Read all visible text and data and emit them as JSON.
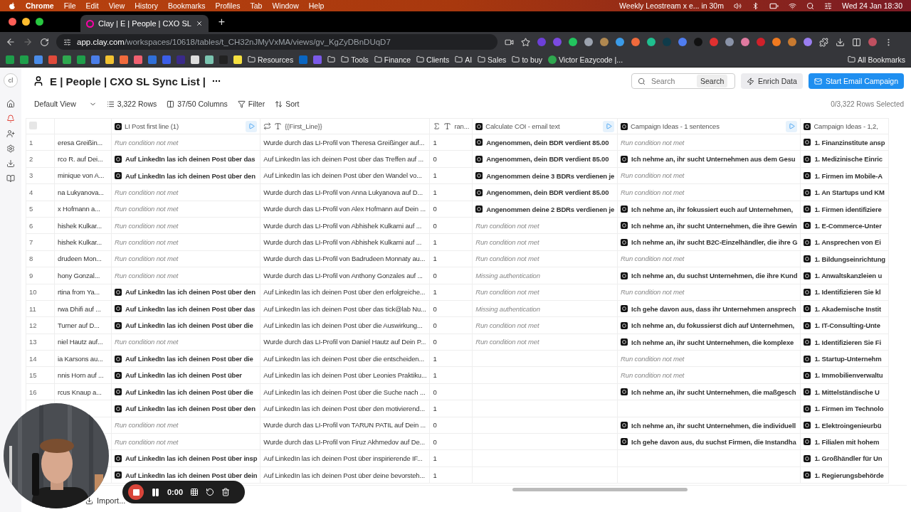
{
  "menubar": {
    "app": "Chrome",
    "menus": [
      "File",
      "Edit",
      "View",
      "History",
      "Bookmarks",
      "Profiles",
      "Tab",
      "Window",
      "Help"
    ],
    "event": "Weekly Leostream x e... in 30m",
    "clock": "Wed 24 Jan  18:30"
  },
  "browser": {
    "tabs": [
      {
        "title": "Clay | E | People | CXO SL",
        "selected": true
      }
    ],
    "new_tab": "+",
    "url_host": "app.clay.com",
    "url_path": "/workspaces/10618/tables/t_CH32nJMyVxMA/views/gv_KgZyDBnDUqD7",
    "extensions": [
      {
        "color": "#6d3fd8"
      },
      {
        "color": "#7b4ae0"
      },
      {
        "color": "#22c55e"
      },
      {
        "color": "#9ca3af"
      },
      {
        "color": "#b08850"
      },
      {
        "color": "#3b9be8"
      },
      {
        "color": "#f06a3c"
      },
      {
        "color": "#1fbf8f"
      },
      {
        "color": "#0f3b4a"
      },
      {
        "color": "#4f7df0"
      },
      {
        "color": "#111111"
      },
      {
        "color": "#e03030"
      },
      {
        "color": "#8a93a8"
      },
      {
        "color": "#e07aa0"
      },
      {
        "color": "#d0202a"
      },
      {
        "color": "#f07a20"
      },
      {
        "color": "#c87a30"
      },
      {
        "color": "#9a7ef0"
      }
    ],
    "bookmarks": [
      {
        "kind": "site",
        "color": "#1e9e4a"
      },
      {
        "kind": "site",
        "color": "#1e9e4a"
      },
      {
        "kind": "site",
        "color": "#4a8ce8"
      },
      {
        "kind": "site",
        "color": "#e04a3a"
      },
      {
        "kind": "site",
        "color": "#2fa84f"
      },
      {
        "kind": "site",
        "color": "#1e9e4a"
      },
      {
        "kind": "site",
        "color": "#4a7ee8"
      },
      {
        "kind": "site",
        "color": "#f2c230"
      },
      {
        "kind": "site",
        "color": "#f06a3c"
      },
      {
        "kind": "site",
        "color": "#f06070"
      },
      {
        "kind": "site",
        "color": "#2f6fd8"
      },
      {
        "kind": "site",
        "color": "#3b5ee8"
      },
      {
        "kind": "site",
        "color": "#3a2a8a"
      },
      {
        "kind": "site",
        "color": "#dddddd"
      },
      {
        "kind": "site",
        "color": "#7ac4b0"
      },
      {
        "kind": "site",
        "color": "#222222"
      },
      {
        "kind": "site",
        "color": "#f5e040"
      },
      {
        "kind": "folder",
        "label": "Resources"
      },
      {
        "kind": "site",
        "color": "#0a66c2"
      },
      {
        "kind": "site",
        "color": "#7b5ae8"
      },
      {
        "kind": "folder_icon"
      },
      {
        "kind": "folder",
        "label": "Tools"
      },
      {
        "kind": "folder",
        "label": "Finance"
      },
      {
        "kind": "folder",
        "label": "Clients"
      },
      {
        "kind": "folder",
        "label": "AI"
      },
      {
        "kind": "folder",
        "label": "Sales"
      },
      {
        "kind": "folder",
        "label": "to buy"
      },
      {
        "kind": "link",
        "label": "Victor Eazycode |...",
        "color": "#2fa84f"
      }
    ],
    "all_bookmarks": "All Bookmarks"
  },
  "workspace": {
    "avatar": "cl",
    "title": "E | People | CXO SL Sync List |",
    "search": {
      "placeholder": "Search",
      "button": "Search"
    },
    "enrich_button": "Enrich Data",
    "campaign_button": "Start Email Campaign",
    "toolbar": {
      "view": "Default View",
      "rows": "3,322 Rows",
      "columns": "37/50 Columns",
      "filter": "Filter",
      "sort": "Sort"
    },
    "selection": "0/3,322 Rows Selected",
    "import": "Import..."
  },
  "table": {
    "select_all": {
      "checked": false
    },
    "columns": [
      {
        "kind": "ai",
        "title": "LI Post first line (1)",
        "run_button": true
      },
      {
        "kind": "text_formula",
        "title": "{{First_Line}}",
        "run_button": false
      },
      {
        "kind": "number_formula",
        "title": "ran...",
        "run_button": false
      },
      {
        "kind": "ai",
        "title": "Calculate COI - email text",
        "run_button": true
      },
      {
        "kind": "ai",
        "title": "Campaign Ideas - 1 sentences",
        "run_button": true
      },
      {
        "kind": "ai",
        "title": "Campaign Ideas - 1,2,",
        "run_button": false
      }
    ],
    "rows": [
      {
        "number": "1",
        "name": "eresa Greißin...",
        "cells": [
          {
            "kind": "status",
            "text": "Run condition not met"
          },
          {
            "kind": "plain",
            "text": "Wurde durch das LI-Profil von Theresa Greißinger auf..."
          },
          {
            "kind": "plain",
            "text": "1"
          },
          {
            "kind": "ai",
            "text": "Angenommen, dein BDR verdient 85.00"
          },
          {
            "kind": "status",
            "text": "Run condition not met"
          },
          {
            "kind": "ai",
            "text": "1. Finanzinstitute ansp"
          }
        ]
      },
      {
        "number": "2",
        "name": "rco R. auf Dei...",
        "cells": [
          {
            "kind": "ai",
            "text": "Auf LinkedIn las ich deinen Post über das"
          },
          {
            "kind": "plain",
            "text": "Auf LinkedIn las ich deinen Post über das Treffen auf ..."
          },
          {
            "kind": "plain",
            "text": "0"
          },
          {
            "kind": "ai",
            "text": "Angenommen, dein BDR verdient 85.00"
          },
          {
            "kind": "ai",
            "text": "Ich nehme an, ihr sucht Unternehmen aus dem Gesu"
          },
          {
            "kind": "ai",
            "text": "1. Medizinische Einric"
          }
        ]
      },
      {
        "number": "3",
        "name": "minique von A...",
        "cells": [
          {
            "kind": "ai",
            "text": "Auf LinkedIn las ich deinen Post über den"
          },
          {
            "kind": "plain",
            "text": "Auf LinkedIn las ich deinen Post über den Wandel vo..."
          },
          {
            "kind": "plain",
            "text": "1"
          },
          {
            "kind": "ai",
            "text": "Angenommen deine 3 BDRs verdienen je"
          },
          {
            "kind": "status",
            "text": "Run condition not met"
          },
          {
            "kind": "ai",
            "text": "1. Firmen im Mobile-A"
          }
        ]
      },
      {
        "number": "4",
        "name": "na Lukyanova...",
        "cells": [
          {
            "kind": "status",
            "text": "Run condition not met"
          },
          {
            "kind": "plain",
            "text": "Wurde durch das LI-Profil von Anna Lukyanova auf D..."
          },
          {
            "kind": "plain",
            "text": "1"
          },
          {
            "kind": "ai",
            "text": "Angenommen, dein BDR verdient 85.00"
          },
          {
            "kind": "status",
            "text": "Run condition not met"
          },
          {
            "kind": "ai",
            "text": "1. An Startups und KM"
          }
        ]
      },
      {
        "number": "5",
        "name": "x Hofmann a...",
        "cells": [
          {
            "kind": "status",
            "text": "Run condition not met"
          },
          {
            "kind": "plain",
            "text": "Wurde durch das LI-Profil von Alex Hofmann auf Dein ..."
          },
          {
            "kind": "plain",
            "text": "0"
          },
          {
            "kind": "ai",
            "text": "Angenommen deine 2 BDRs verdienen je"
          },
          {
            "kind": "ai",
            "text": "Ich nehme an, ihr fokussiert euch auf Unternehmen,"
          },
          {
            "kind": "ai",
            "text": "1. Firmen identifiziere"
          }
        ]
      },
      {
        "number": "6",
        "name": "hishek Kulkar...",
        "cells": [
          {
            "kind": "status",
            "text": "Run condition not met"
          },
          {
            "kind": "plain",
            "text": "Wurde durch das LI-Profil von Abhishek Kulkarni auf ..."
          },
          {
            "kind": "plain",
            "text": "0"
          },
          {
            "kind": "status",
            "text": "Run condition not met"
          },
          {
            "kind": "ai",
            "text": "Ich nehme an, ihr sucht Unternehmen, die ihre Gewin"
          },
          {
            "kind": "ai",
            "text": "1. E-Commerce-Unter"
          }
        ]
      },
      {
        "number": "7",
        "name": "hishek Kulkar...",
        "cells": [
          {
            "kind": "status",
            "text": "Run condition not met"
          },
          {
            "kind": "plain",
            "text": "Wurde durch das LI-Profil von Abhishek Kulkarni auf ..."
          },
          {
            "kind": "plain",
            "text": "1"
          },
          {
            "kind": "status",
            "text": "Run condition not met"
          },
          {
            "kind": "ai",
            "text": "Ich nehme an, ihr sucht B2C-Einzelhändler, die ihre G"
          },
          {
            "kind": "ai",
            "text": "1. Ansprechen von Ei"
          }
        ]
      },
      {
        "number": "8",
        "name": "drudeen Mon...",
        "cells": [
          {
            "kind": "status",
            "text": "Run condition not met"
          },
          {
            "kind": "plain",
            "text": "Wurde durch das LI-Profil von Badrudeen Monnaty au..."
          },
          {
            "kind": "plain",
            "text": "1"
          },
          {
            "kind": "status",
            "text": "Run condition not met"
          },
          {
            "kind": "status",
            "text": "Run condition not met"
          },
          {
            "kind": "ai",
            "text": "1. Bildungseinrichtung"
          }
        ]
      },
      {
        "number": "9",
        "name": "hony Gonzal...",
        "cells": [
          {
            "kind": "status",
            "text": "Run condition not met"
          },
          {
            "kind": "plain",
            "text": "Wurde durch das LI-Profil von Anthony Gonzales auf ..."
          },
          {
            "kind": "plain",
            "text": "0"
          },
          {
            "kind": "status",
            "text": "Missing authentication"
          },
          {
            "kind": "ai",
            "text": "Ich nehme an, du suchst Unternehmen, die ihre Kund"
          },
          {
            "kind": "ai",
            "text": "1. Anwaltskanzleien u"
          }
        ]
      },
      {
        "number": "10",
        "name": "rtina from Ya...",
        "cells": [
          {
            "kind": "ai",
            "text": "Auf LinkedIn las ich deinen Post über den"
          },
          {
            "kind": "plain",
            "text": "Auf LinkedIn las ich deinen Post über den erfolgreiche..."
          },
          {
            "kind": "plain",
            "text": "1"
          },
          {
            "kind": "status",
            "text": "Run condition not met"
          },
          {
            "kind": "status",
            "text": "Run condition not met"
          },
          {
            "kind": "ai",
            "text": "1. Identifizieren Sie kl"
          }
        ]
      },
      {
        "number": "11",
        "name": "rwa Dhifi auf ...",
        "cells": [
          {
            "kind": "ai",
            "text": "Auf LinkedIn las ich deinen Post über das"
          },
          {
            "kind": "plain",
            "text": "Auf LinkedIn las ich deinen Post über das tick@lab Nu..."
          },
          {
            "kind": "plain",
            "text": "0"
          },
          {
            "kind": "status",
            "text": "Missing authentication"
          },
          {
            "kind": "ai",
            "text": "Ich gehe davon aus, dass ihr Unternehmen ansprech"
          },
          {
            "kind": "ai",
            "text": "1. Akademische Instit"
          }
        ]
      },
      {
        "number": "12",
        "name": "Turner auf D...",
        "cells": [
          {
            "kind": "ai",
            "text": "Auf LinkedIn las ich deinen Post über die"
          },
          {
            "kind": "plain",
            "text": "Auf LinkedIn las ich deinen Post über die Auswirkung..."
          },
          {
            "kind": "plain",
            "text": "0"
          },
          {
            "kind": "status",
            "text": "Run condition not met"
          },
          {
            "kind": "ai",
            "text": "Ich nehme an, du fokussierst dich auf Unternehmen,"
          },
          {
            "kind": "ai",
            "text": "1. IT-Consulting-Unte"
          }
        ]
      },
      {
        "number": "13",
        "name": "niel Hautz auf...",
        "cells": [
          {
            "kind": "status",
            "text": "Run condition not met"
          },
          {
            "kind": "plain",
            "text": "Wurde durch das LI-Profil von Daniel Hautz auf Dein P..."
          },
          {
            "kind": "plain",
            "text": "0"
          },
          {
            "kind": "status",
            "text": "Run condition not met"
          },
          {
            "kind": "ai",
            "text": "Ich nehme an, ihr sucht Unternehmen, die komplexe"
          },
          {
            "kind": "ai",
            "text": "1. Identifizieren Sie Fi"
          }
        ]
      },
      {
        "number": "14",
        "name": "ia Karsons au...",
        "cells": [
          {
            "kind": "ai",
            "text": "Auf LinkedIn las ich deinen Post über die"
          },
          {
            "kind": "plain",
            "text": "Auf LinkedIn las ich deinen Post über die entscheiden..."
          },
          {
            "kind": "plain",
            "text": "1"
          },
          {
            "kind": "empty"
          },
          {
            "kind": "status",
            "text": "Run condition not met"
          },
          {
            "kind": "ai",
            "text": "1. Startup-Unternehm"
          }
        ]
      },
      {
        "number": "15",
        "name": "nnis Horn auf ...",
        "cells": [
          {
            "kind": "ai",
            "text": "Auf LinkedIn las ich deinen Post über"
          },
          {
            "kind": "plain",
            "text": "Auf LinkedIn las ich deinen Post über Leonies Praktiku..."
          },
          {
            "kind": "plain",
            "text": "1"
          },
          {
            "kind": "empty"
          },
          {
            "kind": "status",
            "text": "Run condition not met"
          },
          {
            "kind": "ai",
            "text": "1. Immobilienverwaltu"
          }
        ]
      },
      {
        "number": "16",
        "name": "rcus Knaup a...",
        "cells": [
          {
            "kind": "ai",
            "text": "Auf LinkedIn las ich deinen Post über die"
          },
          {
            "kind": "plain",
            "text": "Auf LinkedIn las ich deinen Post über die Suche nach ..."
          },
          {
            "kind": "plain",
            "text": "0"
          },
          {
            "kind": "empty"
          },
          {
            "kind": "ai",
            "text": "Ich nehme an, ihr sucht Unternehmen, die maßgesch"
          },
          {
            "kind": "ai",
            "text": "1. Mittelständische U"
          }
        ]
      },
      {
        "cells": [
          {
            "kind": "ai",
            "text": "Auf LinkedIn las ich deinen Post über den"
          },
          {
            "kind": "plain",
            "text": "Auf LinkedIn las ich deinen Post über den motivierend..."
          },
          {
            "kind": "plain",
            "text": "1"
          },
          {
            "kind": "empty"
          },
          {
            "kind": "empty"
          },
          {
            "kind": "ai",
            "text": "1. Firmen im Technolo"
          }
        ]
      },
      {
        "cells": [
          {
            "kind": "status",
            "text": "Run condition not met"
          },
          {
            "kind": "plain",
            "text": "Wurde durch das LI-Profil von TARUN PATIL auf Dein ..."
          },
          {
            "kind": "plain",
            "text": "0"
          },
          {
            "kind": "empty"
          },
          {
            "kind": "ai",
            "text": "Ich nehme an, ihr sucht Unternehmen, die individuell"
          },
          {
            "kind": "ai",
            "text": "1. Elektroingenieurbü"
          }
        ]
      },
      {
        "cells": [
          {
            "kind": "status",
            "text": "Run condition not met"
          },
          {
            "kind": "plain",
            "text": "Wurde durch das LI-Profil von Firuz Akhmedov auf De..."
          },
          {
            "kind": "plain",
            "text": "0"
          },
          {
            "kind": "empty"
          },
          {
            "kind": "ai",
            "text": "Ich gehe davon aus, du suchst Firmen, die Instandha"
          },
          {
            "kind": "ai",
            "text": "1. Filialen mit hohem"
          }
        ]
      },
      {
        "cells": [
          {
            "kind": "ai",
            "text": "Auf LinkedIn las ich deinen Post über insp"
          },
          {
            "kind": "plain",
            "text": "Auf LinkedIn las ich deinen Post über inspirierende IF..."
          },
          {
            "kind": "plain",
            "text": "1"
          },
          {
            "kind": "empty"
          },
          {
            "kind": "empty"
          },
          {
            "kind": "ai",
            "text": "1. Großhändler für Un"
          }
        ]
      },
      {
        "cells": [
          {
            "kind": "ai",
            "text": "Auf LinkedIn las ich deinen Post über dein"
          },
          {
            "kind": "plain",
            "text": "Auf LinkedIn las ich deinen Post über deine bevorsteh..."
          },
          {
            "kind": "plain",
            "text": "1"
          },
          {
            "kind": "empty"
          },
          {
            "kind": "empty"
          },
          {
            "kind": "ai",
            "text": "1. Regierungsbehörde"
          }
        ]
      }
    ]
  },
  "recorder": {
    "time": "0:00"
  }
}
